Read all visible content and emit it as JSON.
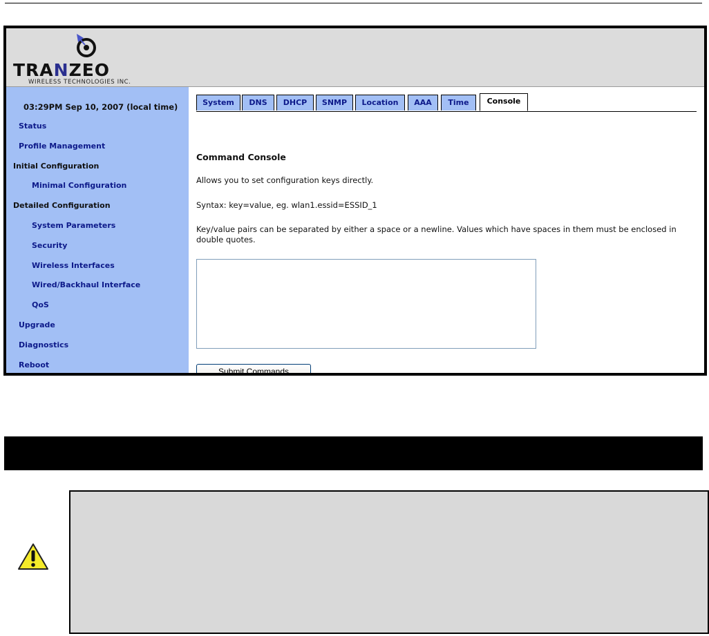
{
  "logo": {
    "name_part1": "TRA",
    "name_accent": "N",
    "name_part2": "ZEO",
    "subtitle": "WIRELESS TECHNOLOGIES INC."
  },
  "sidebar": {
    "clock": "03:29PM Sep 10, 2007 (local time)",
    "items": [
      {
        "label": "Status"
      },
      {
        "label": "Profile Management"
      },
      {
        "label": "Initial Configuration"
      },
      {
        "label": "Minimal Configuration"
      },
      {
        "label": "Detailed Configuration"
      },
      {
        "label": "System Parameters"
      },
      {
        "label": "Security"
      },
      {
        "label": "Wireless Interfaces"
      },
      {
        "label": "Wired/Backhaul Interface"
      },
      {
        "label": "QoS"
      },
      {
        "label": "Upgrade"
      },
      {
        "label": "Diagnostics"
      },
      {
        "label": "Reboot"
      }
    ]
  },
  "tabs": [
    {
      "label": "System"
    },
    {
      "label": "DNS"
    },
    {
      "label": "DHCP"
    },
    {
      "label": "SNMP"
    },
    {
      "label": "Location"
    },
    {
      "label": "AAA"
    },
    {
      "label": "Time"
    },
    {
      "label": "Console"
    }
  ],
  "active_tab": "Console",
  "console": {
    "heading": "Command Console",
    "description": "Allows you to set configuration keys directly.",
    "syntax": "Syntax: key=value, eg. wlan1.essid=ESSID_1",
    "note": "Key/value pairs can be separated by either a space or a newline. Values which have spaces in them must be enclosed in double quotes.",
    "commands_value": "",
    "submit_label": "Submit Commands"
  },
  "colors": {
    "sidebar_bg": "#a2bff5",
    "header_bg": "#dcdcdc",
    "link": "#0d1a8a",
    "warning_yellow": "#f4ea2a"
  },
  "icons": {
    "warning": "warning-triangle-icon",
    "logo_mark": "antenna-signal-logo-icon"
  }
}
